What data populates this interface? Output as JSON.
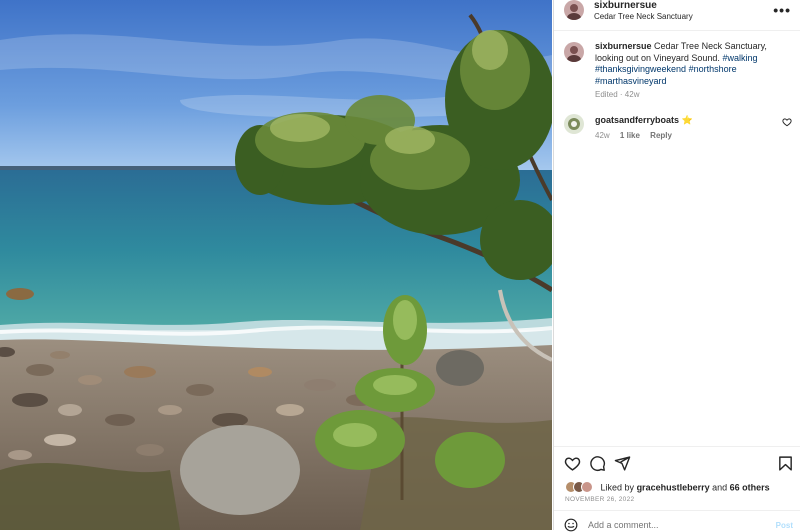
{
  "post": {
    "username": "sixburnersue",
    "location": "Cedar Tree Neck Sanctuary",
    "caption_user": "sixburnersue",
    "caption_text": "Cedar Tree Neck Sanctuary, looking out on Vineyard Sound.",
    "hashtags": [
      "#walking",
      "#thanksgivingweekend",
      "#northshore",
      "#marthasvineyard"
    ],
    "edited": "Edited · 42w",
    "more_icon": "more-horizontal-icon"
  },
  "comments": [
    {
      "username": "goatsandferryboats",
      "text": "⭐",
      "age": "42w",
      "likes": "1 like",
      "reply": "Reply"
    }
  ],
  "actions": {
    "icons": [
      "heart-icon",
      "comment-icon",
      "share-icon",
      "bookmark-icon"
    ]
  },
  "likes": {
    "prefix": "Liked by",
    "user": "gracehustleberry",
    "and": "and",
    "others": "66 others"
  },
  "date": "NOVEMBER 26, 2022",
  "comment_box": {
    "placeholder": "Add a comment...",
    "post_label": "Post"
  },
  "colors": {
    "link": "#00376b",
    "muted": "#8e8e8e",
    "post_disabled": "#b2dffc"
  }
}
